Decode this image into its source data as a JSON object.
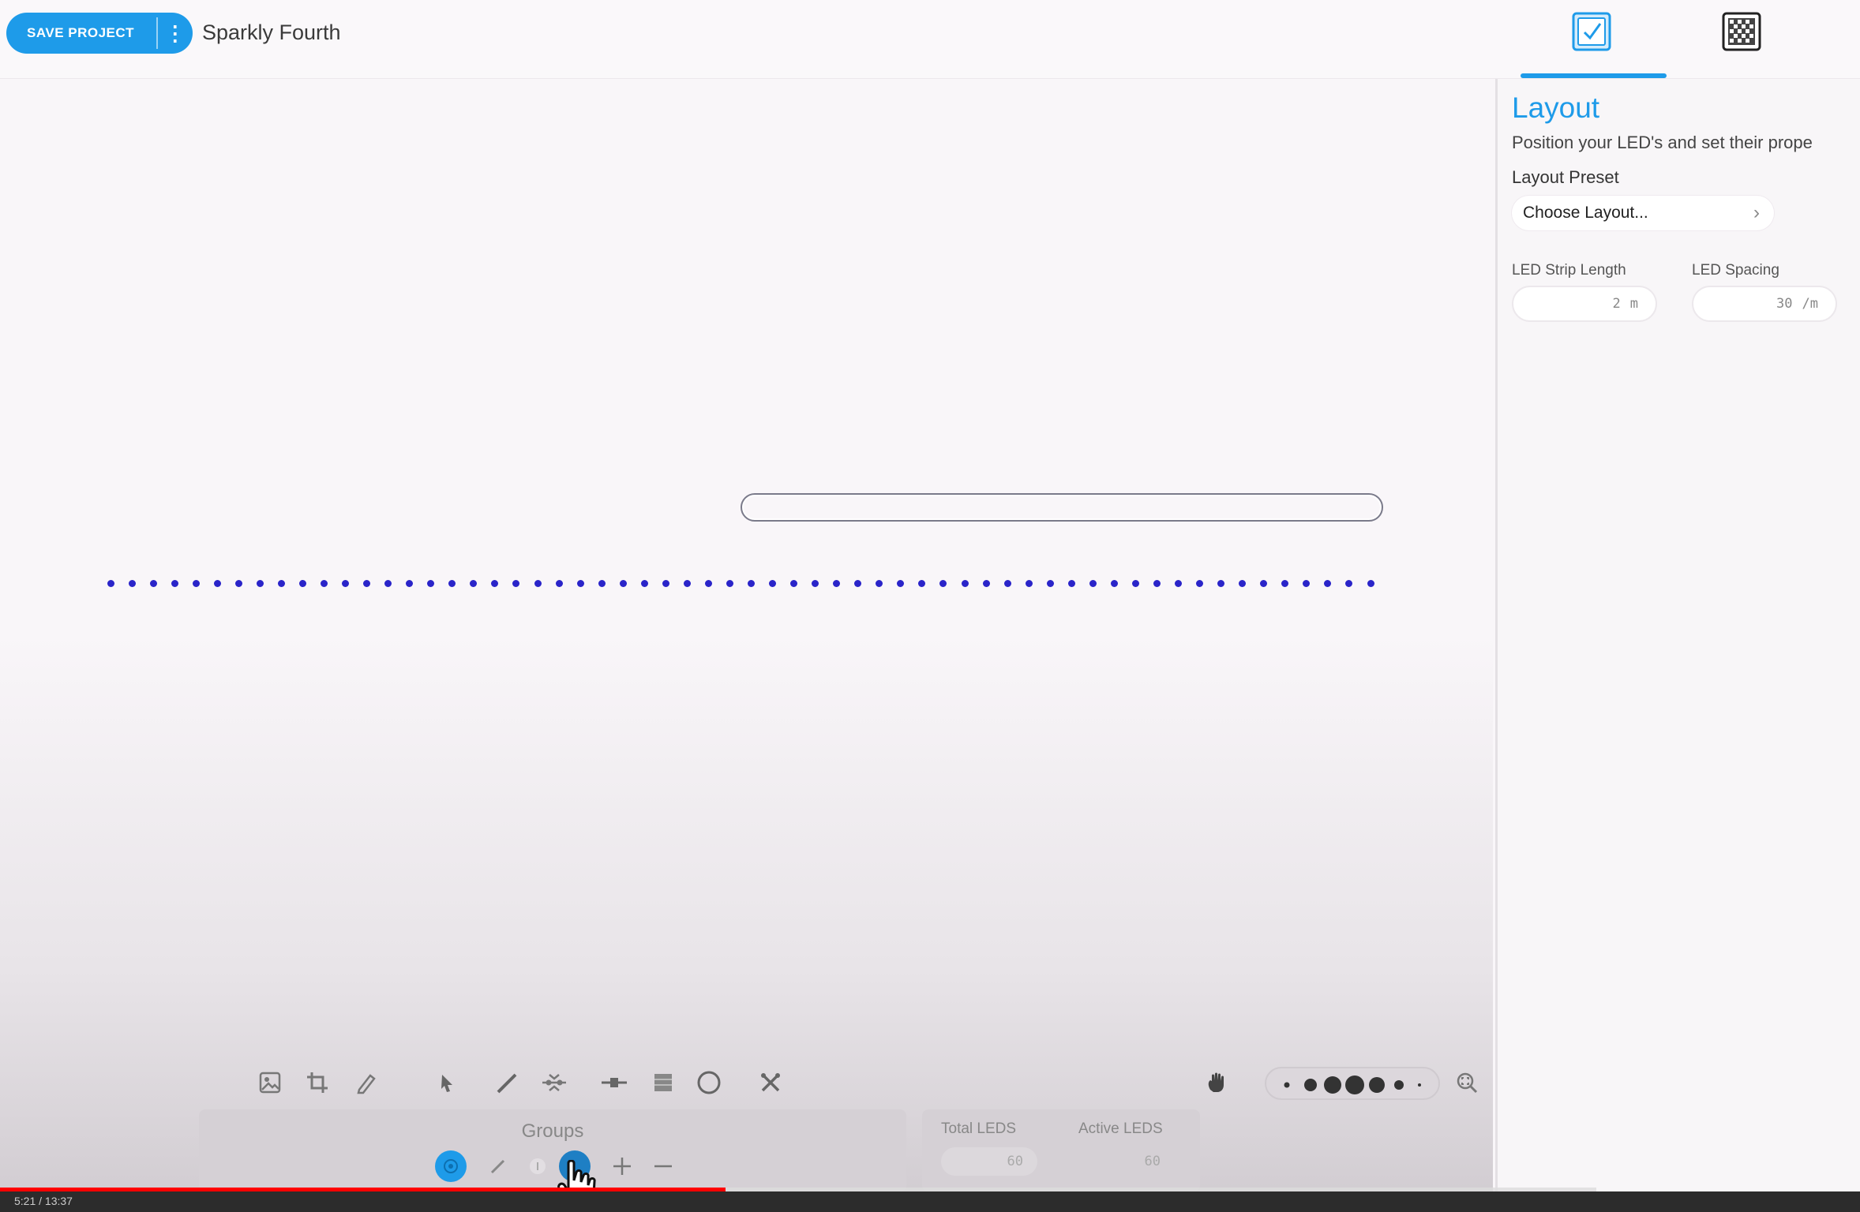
{
  "topbar": {
    "save_label": "SAVE PROJECT",
    "menu_glyph": "⋮",
    "project_name": "Sparkly Fourth",
    "tabs": [
      {
        "icon": "layout-icon",
        "active": true
      },
      {
        "icon": "matrix-icon",
        "active": false
      }
    ]
  },
  "panel": {
    "title": "Layout",
    "description": "Position your LED's and set their prope",
    "preset_label": "Layout Preset",
    "preset_value": "Choose Layout...",
    "preset_chevron": "›",
    "strip_length_label": "LED Strip Length",
    "strip_length_value": "2",
    "strip_length_unit": "m",
    "spacing_label": "LED Spacing",
    "spacing_value": "30",
    "spacing_unit": "/m"
  },
  "canvas": {
    "led_count_total": 60,
    "selected_range": [
      30,
      59
    ],
    "led_color": "#2a24c9"
  },
  "toolbar": {
    "tools": [
      "image-icon",
      "crop-icon",
      "pencil-icon",
      "pointer-icon",
      "draw-line-icon",
      "distribute-icon",
      "connect-icon",
      "grid-icon",
      "circle-icon",
      "cut-icon"
    ],
    "pan_icon": "hand-icon",
    "zoom_icon": "zoom-fit-icon"
  },
  "groups": {
    "title": "Groups",
    "buttons": [
      "group-select-icon",
      "group-edit-icon",
      "group-info-icon",
      "group-color-icon",
      "plus-icon",
      "minus-icon"
    ]
  },
  "stats": {
    "total_label": "Total LEDS",
    "total_value": "60",
    "active_label": "Active LEDS",
    "active_value": "60"
  },
  "video": {
    "progress": 0.39,
    "time": "5:21 / 13:37"
  },
  "colors": {
    "accent": "#1e9be9",
    "progress_red": "#ff0000"
  }
}
